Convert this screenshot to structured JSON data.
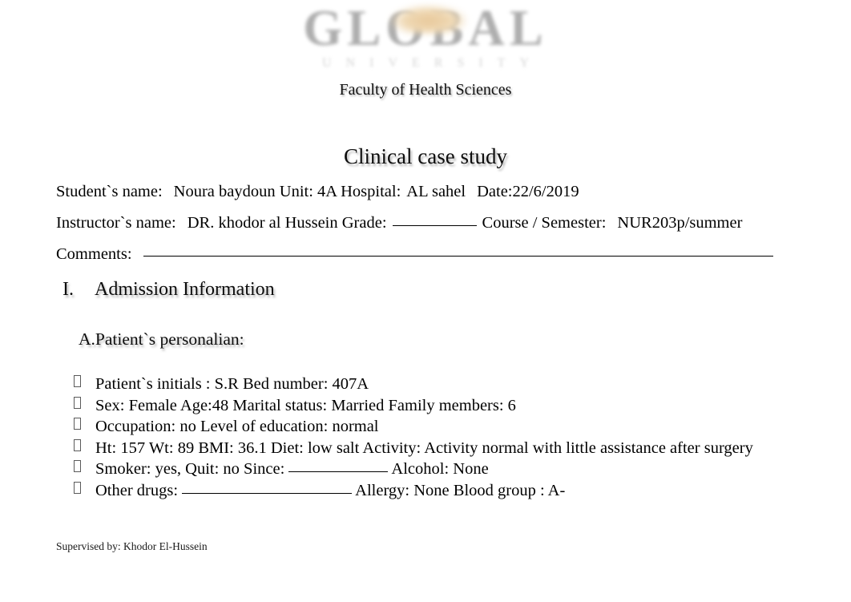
{
  "logo": {
    "wordmark": "GLOBAL",
    "subtext": "UNIVERSITY",
    "accent_color": "#e8c89a",
    "wordmark_color": "#8f8f8f"
  },
  "header": {
    "faculty": "Faculty of Health Sciences",
    "title": "Clinical case study"
  },
  "student_line": {
    "student_label": "Student`s name:",
    "student_value": "Noura baydoun",
    "unit_label": "Unit:",
    "unit_value": "4A",
    "hospital_label": "Hospital:",
    "hospital_value": "AL sahel",
    "date_label_value": "Date:22/6/2019"
  },
  "instructor_line": {
    "instructor_label": "Instructor`s name:",
    "instructor_value": "DR. khodor al Hussein",
    "grade_label": "Grade:",
    "grade_value": "",
    "course_label": "Course / Semester:",
    "course_value": "NUR203p/summer"
  },
  "comments_line": {
    "label": "Comments:",
    "value": ""
  },
  "section": {
    "number": "I.",
    "title": "Admission Information"
  },
  "subsection": {
    "title": "A.Patient`s personalian:"
  },
  "fields": [
    {
      "bullet": "tofu-box",
      "parts": [
        {
          "type": "text",
          "text": "Patient`s initials  : S.R Bed number:  407A"
        }
      ]
    },
    {
      "bullet": "tofu-box",
      "parts": [
        {
          "type": "text",
          "text": "Sex: Female Age:48 Marital status:   Married Family members:   6"
        }
      ]
    },
    {
      "bullet": "tofu-box",
      "parts": [
        {
          "type": "text",
          "text": "Occupation: no Level of education:  normal"
        }
      ]
    },
    {
      "bullet": "tofu-box",
      "parts": [
        {
          "type": "text",
          "text": "Ht:  157 Wt: 89 BMI: 36.1 Diet: low salt Activity:   Activity normal with little assistance after surgery"
        }
      ]
    },
    {
      "bullet": "tofu-box",
      "parts": [
        {
          "type": "text",
          "text": "Smoker: yes, Quit:   no Since: "
        },
        {
          "type": "blank",
          "width": "a"
        },
        {
          "type": "text",
          "text": " Alcohol: None"
        }
      ]
    },
    {
      "bullet": "tofu-box",
      "parts": [
        {
          "type": "text",
          "text": "Other drugs:   "
        },
        {
          "type": "blank",
          "width": "b"
        },
        {
          "type": "text",
          "text": " Allergy: None Blood group : A-"
        }
      ]
    }
  ],
  "footer": {
    "supervised_by": "Supervised by: Khodor El-Hussein"
  }
}
